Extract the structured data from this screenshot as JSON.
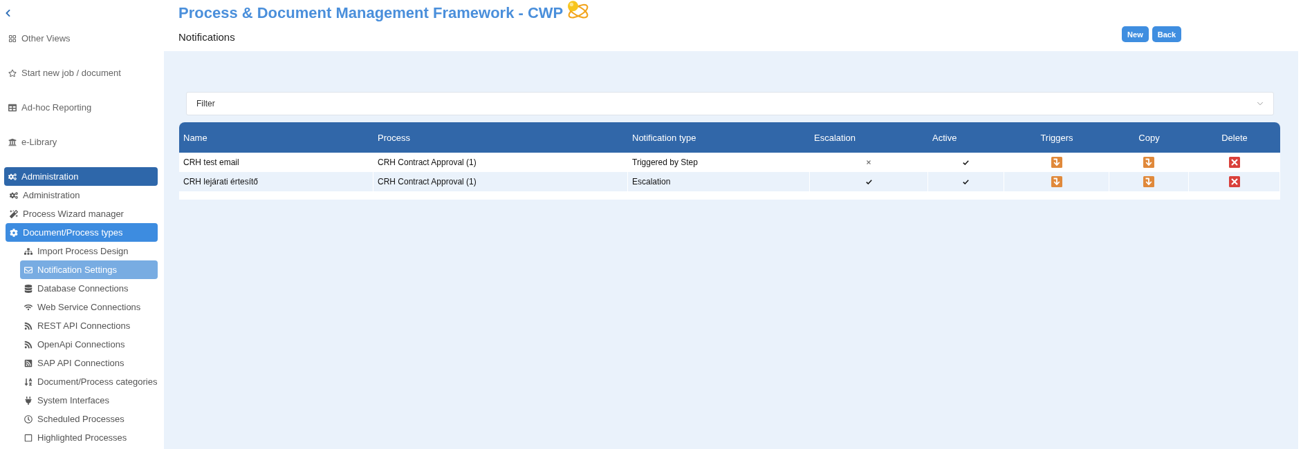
{
  "sidebar": {
    "items": [
      {
        "label": "Other Views",
        "selected": false,
        "expanded": false
      },
      {
        "label": "Start new job / document",
        "selected": false,
        "expanded": false
      },
      {
        "label": "Ad-hoc Reporting",
        "selected": false,
        "expanded": false
      },
      {
        "label": "e-Library",
        "selected": false,
        "expanded": false
      },
      {
        "label": "Administration",
        "selected": false,
        "expanded": true,
        "children": [
          {
            "label": "Administration",
            "selected": false,
            "expanded": false
          },
          {
            "label": "Process Wizard manager",
            "selected": false,
            "expanded": false
          },
          {
            "label": "Document/Process types",
            "selected": false,
            "expanded": true,
            "children": [
              {
                "label": "Import Process Design",
                "selected": false,
                "expanded": false
              },
              {
                "label": "Notification Settings",
                "selected": true,
                "expanded": false
              },
              {
                "label": "Database Connections",
                "selected": false,
                "expanded": false
              },
              {
                "label": "Web Service Connections",
                "selected": false,
                "expanded": false
              },
              {
                "label": "REST API Connections",
                "selected": false,
                "expanded": false
              },
              {
                "label": "OpenApi Connections",
                "selected": false,
                "expanded": false
              },
              {
                "label": "SAP API Connections",
                "selected": false,
                "expanded": false
              },
              {
                "label": "Document/Process categories",
                "selected": false,
                "expanded": false
              },
              {
                "label": "System Interfaces",
                "selected": false,
                "expanded": false
              },
              {
                "label": "Scheduled Processes",
                "selected": false,
                "expanded": false
              },
              {
                "label": "Highlighted Processes",
                "selected": false,
                "expanded": false
              }
            ]
          }
        ]
      }
    ]
  },
  "header": {
    "title": "Process & Document Management Framework - CWP",
    "page_title": "Notifications",
    "buttons": [
      "New",
      "Back"
    ]
  },
  "filter": {
    "label": "Filter",
    "expanded": false
  },
  "table": {
    "columns": [
      "Name",
      "Process",
      "Notification type",
      "Escalation",
      "Active",
      "Triggers",
      "Copy",
      "Delete"
    ],
    "rows": [
      {
        "name": "CRH test email",
        "process": "CRH Contract Approval (1)",
        "notification_type": "Triggered by Step",
        "escalation": false,
        "active": true
      },
      {
        "name": "CRH lejárati értesítő",
        "process": "CRH Contract Approval (1)",
        "notification_type": "Escalation",
        "escalation": true,
        "active": true
      }
    ]
  }
}
